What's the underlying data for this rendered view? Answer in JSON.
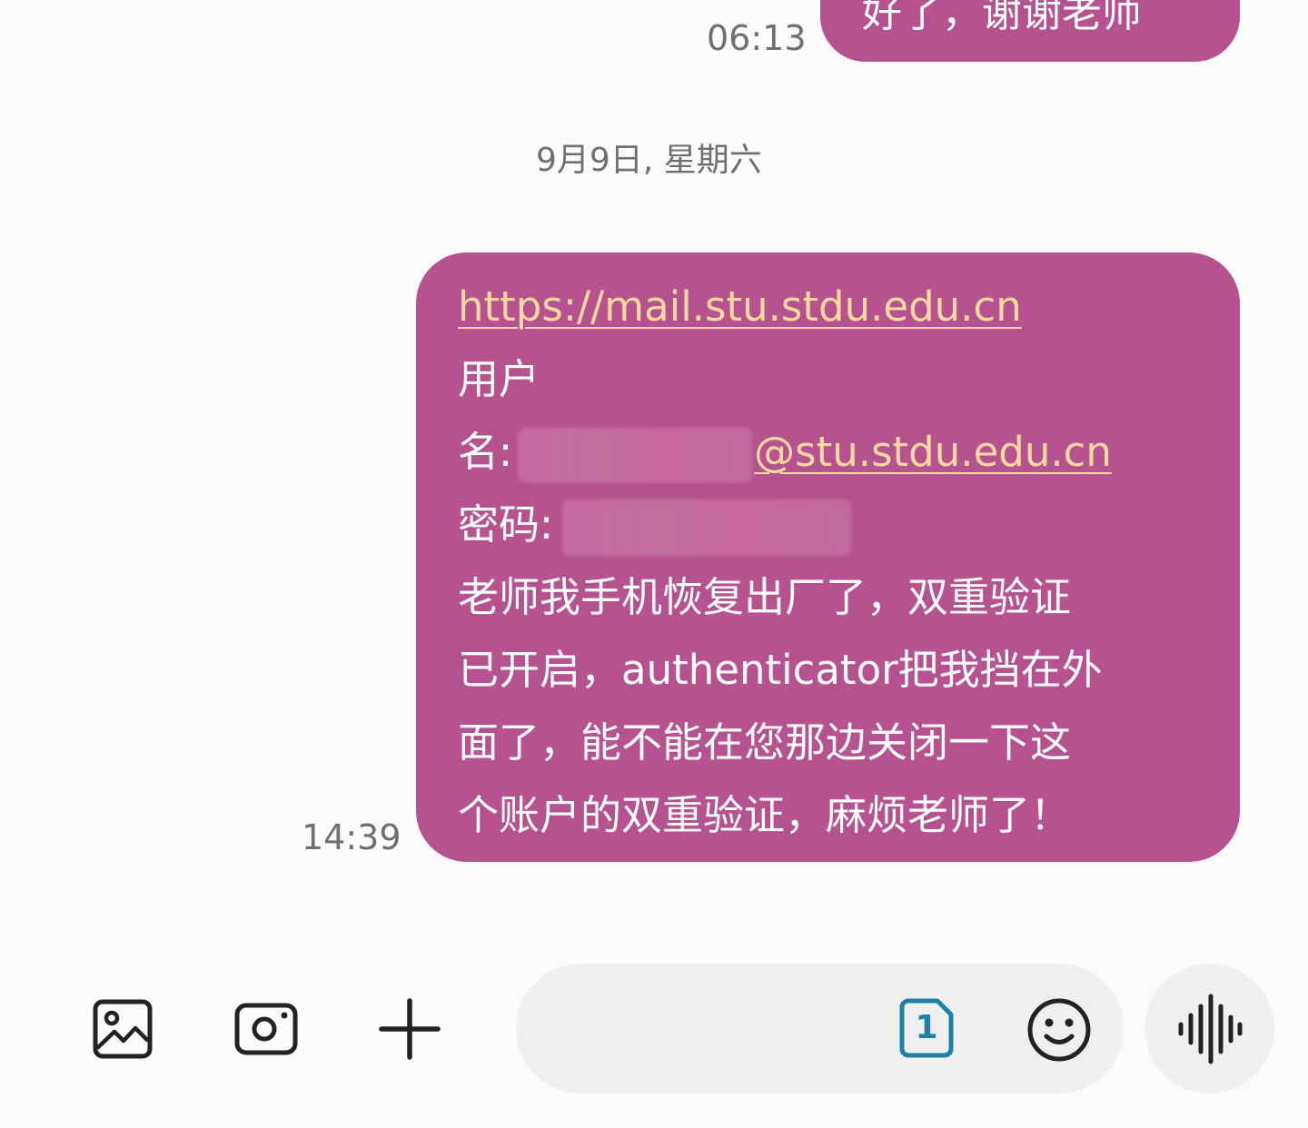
{
  "conversation": {
    "previous_message": {
      "text": "好了，谢谢老师",
      "time": "06:13"
    },
    "date_divider": "9月9日, 星期六",
    "message": {
      "link": "https://mail.stu.stdu.edu.cn",
      "username_label_line1": "用户",
      "username_label_line2": "名:",
      "username_domain": "@stu.stdu.edu.cn",
      "password_label": "密码:",
      "body_lines": [
        "老师我手机恢复出厂了，双重验证",
        "已开启，authenticator把我挡在外",
        "面了，能不能在您那边关闭一下这",
        "个账户的双重验证，麻烦老师了！"
      ],
      "time": "14:39"
    }
  },
  "composer": {
    "sim_label": "1",
    "icons": {
      "gallery": "gallery-icon",
      "camera": "camera-icon",
      "add": "plus-icon",
      "sim": "sim-card-icon",
      "emoji": "emoji-icon",
      "voice": "voice-waveform-icon"
    }
  },
  "colors": {
    "bubble": "#b5528f",
    "link": "#fcd9a0",
    "background": "#fbfbfb",
    "input_background": "#efefef",
    "sim_accent": "#1f7fa6",
    "timestamp": "#6f6f6f"
  }
}
